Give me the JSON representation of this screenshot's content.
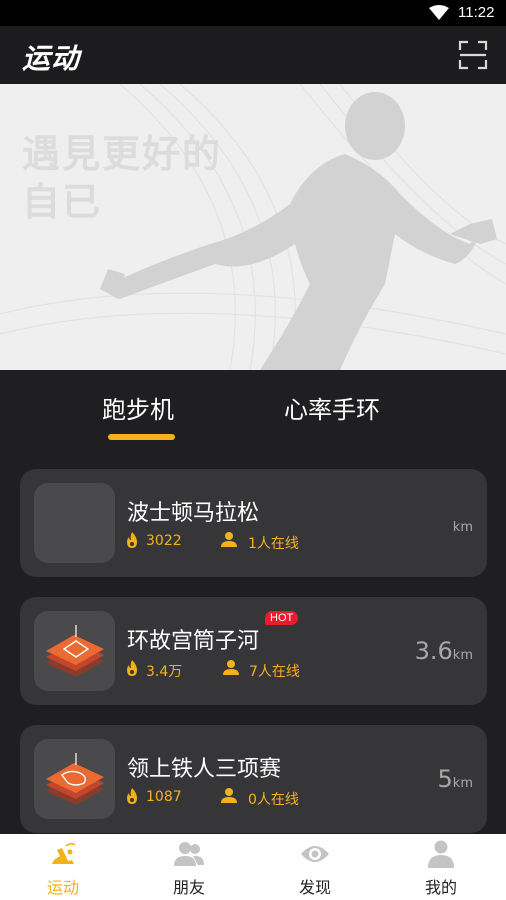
{
  "status_bar": {
    "time": "11:22"
  },
  "header": {
    "title": "运动"
  },
  "banner": {
    "slogan_line1": "遇見更好的",
    "slogan_line2": "自已"
  },
  "tabs": [
    {
      "label": "跑步机",
      "active": true
    },
    {
      "label": "心率手环",
      "active": false
    }
  ],
  "routes": [
    {
      "name": "波士顿马拉松",
      "heat": "3022",
      "online": "1人在线",
      "distance": "",
      "unit": "km",
      "hot": false
    },
    {
      "name": "环故宫筒子河",
      "heat": "3.4万",
      "online": "7人在线",
      "distance": "3.6",
      "unit": "km",
      "hot": true,
      "hot_label": "HOT"
    },
    {
      "name": "领上铁人三项赛",
      "heat": "1087",
      "online": "0人在线",
      "distance": "5",
      "unit": "km",
      "hot": false
    }
  ],
  "bottom_nav": [
    {
      "label": "运动",
      "icon": "run-icon",
      "active": true
    },
    {
      "label": "朋友",
      "icon": "friends-icon",
      "active": false
    },
    {
      "label": "发现",
      "icon": "eye-icon",
      "active": false
    },
    {
      "label": "我的",
      "icon": "user-icon",
      "active": false
    }
  ],
  "colors": {
    "accent": "#f4b21a",
    "card_bg": "#363638",
    "page_bg": "#1f1f21",
    "hot_badge": "#e81c2c"
  }
}
